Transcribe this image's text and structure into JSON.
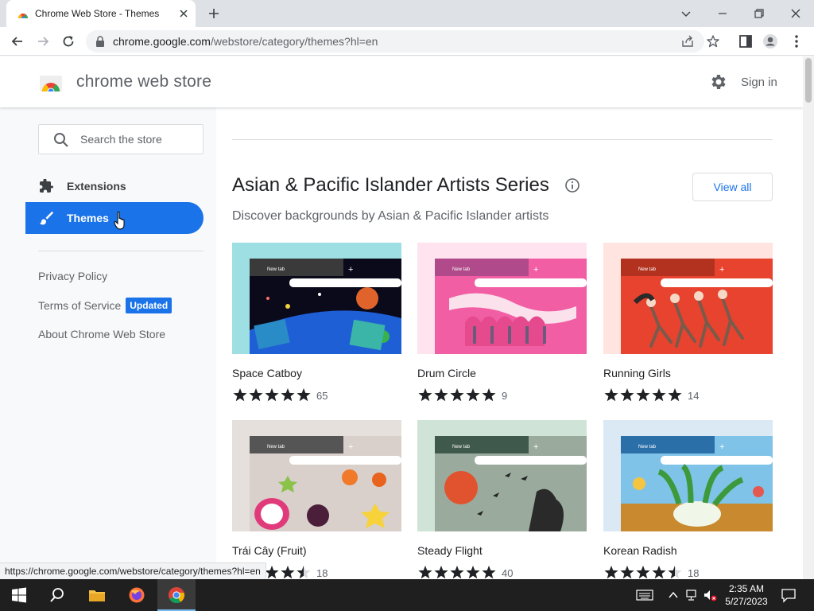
{
  "browser": {
    "tab_title": "Chrome Web Store - Themes",
    "url_host": "chrome.google.com",
    "url_path": "/webstore/category/themes?hl=en",
    "status_url": "https://chrome.google.com/webstore/category/themes?hl=en"
  },
  "header": {
    "title": "chrome web store",
    "signin_label": "Sign in"
  },
  "sidebar": {
    "search_placeholder": "Search the store",
    "nav": [
      {
        "label": "Extensions",
        "icon": "puzzle-icon",
        "active": false
      },
      {
        "label": "Themes",
        "icon": "brush-icon",
        "active": true
      }
    ],
    "links": {
      "privacy": "Privacy Policy",
      "terms": "Terms of Service",
      "terms_badge": "Updated",
      "about": "About Chrome Web Store"
    }
  },
  "section": {
    "title": "Asian & Pacific Islander Artists Series",
    "subtitle": "Discover backgrounds by Asian & Pacific Islander artists",
    "view_all_label": "View all"
  },
  "themes": [
    {
      "name": "Space Catboy",
      "rating": 5.0,
      "count": "65"
    },
    {
      "name": "Drum Circle",
      "rating": 5.0,
      "count": "9"
    },
    {
      "name": "Running Girls",
      "rating": 5.0,
      "count": "14"
    },
    {
      "name": "Trái Cây (Fruit)",
      "rating": 4.5,
      "count": "18"
    },
    {
      "name": "Steady Flight",
      "rating": 5.0,
      "count": "40"
    },
    {
      "name": "Korean Radish",
      "rating": 4.5,
      "count": "18"
    }
  ],
  "thumb_mock": {
    "tab_label": "New tab"
  },
  "taskbar": {
    "time": "2:35 AM",
    "date": "5/27/2023"
  },
  "colors": {
    "accent": "#1a73e8",
    "taskbar": "#1f1f1f"
  }
}
